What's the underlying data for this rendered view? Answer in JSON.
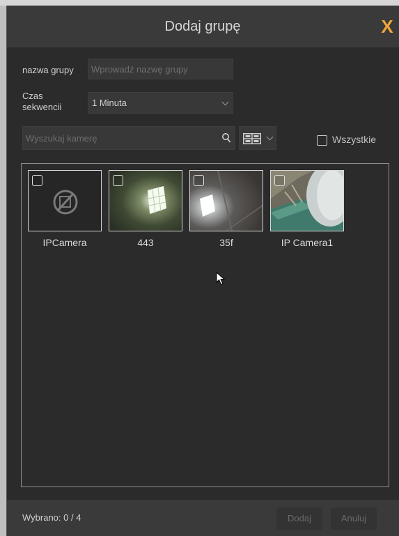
{
  "dialog": {
    "title": "Dodaj grupę",
    "close_symbol": "X"
  },
  "form": {
    "group_name_label": "nazwa grupy",
    "group_name_value": "",
    "group_name_placeholder": "Wprowadź nazwę grupy",
    "sequence_time_label_line1": "Czas",
    "sequence_time_label_line2": "sekwencii",
    "sequence_time_value": "1 Minuta"
  },
  "search": {
    "placeholder": "Wyszukaj kamerę",
    "value": "",
    "search_icon": "search-icon",
    "view_mode_icon": "grid-view-icon"
  },
  "select_all": {
    "label": "Wszystkie",
    "checked": false
  },
  "cameras": [
    {
      "name": "IPCamera",
      "checked": false,
      "thumbnail": "no-video-icon"
    },
    {
      "name": "443",
      "checked": false,
      "thumbnail": "live-preview"
    },
    {
      "name": "35f",
      "checked": false,
      "thumbnail": "live-preview"
    },
    {
      "name": "IP Camera1",
      "checked": false,
      "thumbnail": "live-preview"
    }
  ],
  "footer": {
    "selected_text": "Wybrano: 0 / 4",
    "add_label": "Dodaj",
    "cancel_label": "Anuluj"
  },
  "colors": {
    "accent_close": "#f1a43a",
    "dialog_bg": "#2b2b2b",
    "titlebar_bg": "#3a3a3a"
  }
}
